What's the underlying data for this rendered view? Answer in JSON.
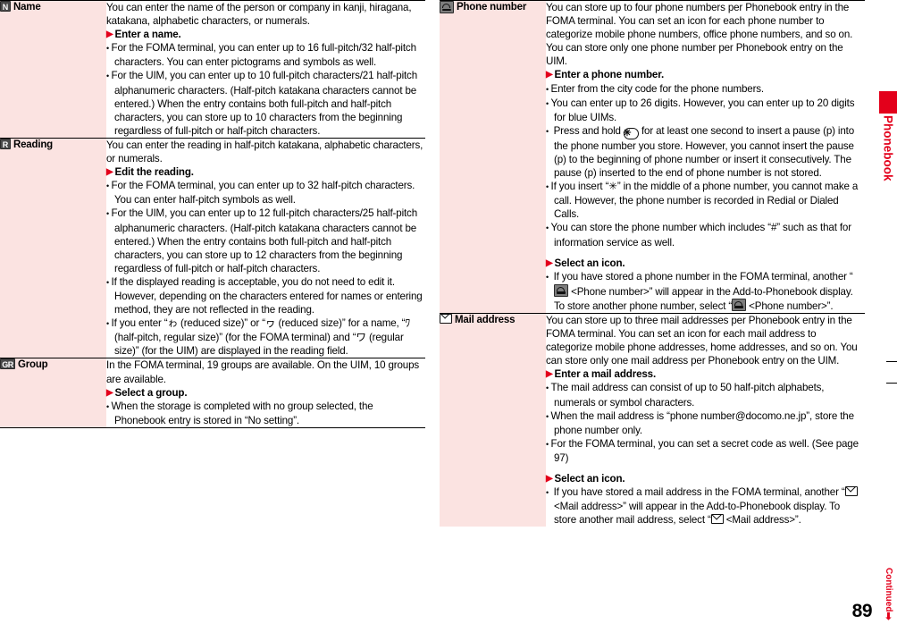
{
  "page": {
    "number": "89",
    "continued_label": "Continued",
    "side_tab_label": "Phonebook",
    "accent_color": "#e3001b",
    "label_bg_color": "#fbe3e1"
  },
  "left_column": {
    "rows": [
      {
        "icon_name": "name-icon",
        "icon_glyph": "N",
        "label": "Name",
        "blocks": [
          {
            "type": "para",
            "text": "You can enter the name of the person or company in kanji, hiragana, katakana, alphabetic characters, or numerals."
          },
          {
            "type": "heading",
            "text": "Enter a name."
          },
          {
            "type": "bullet",
            "text": "For the FOMA terminal, you can enter up to 16 full-pitch/32 half-pitch characters. You can enter pictograms and symbols as well."
          },
          {
            "type": "bullet",
            "text": "For the UIM, you can enter up to 10 full-pitch characters/21 half-pitch alphanumeric characters. (Half-pitch katakana characters cannot be entered.) When the entry contains both full-pitch and half-pitch characters, you can store up to 10 characters from the beginning regardless of full-pitch or half-pitch characters."
          }
        ]
      },
      {
        "icon_name": "reading-icon",
        "icon_glyph": "R",
        "label": "Reading",
        "blocks": [
          {
            "type": "para",
            "text": "You can enter the reading in half-pitch katakana, alphabetic characters, or numerals."
          },
          {
            "type": "heading",
            "text": "Edit the reading."
          },
          {
            "type": "bullet",
            "text": "For the FOMA terminal, you can enter up to 32 half-pitch characters. You can enter half-pitch symbols as well."
          },
          {
            "type": "bullet",
            "text": "For the UIM, you can enter up to 12 full-pitch characters/25 half-pitch alphanumeric characters. (Half-pitch katakana characters cannot be entered.) When the entry contains both full-pitch and half-pitch characters, you can store up to 12 characters from the beginning regardless of full-pitch or half-pitch characters."
          },
          {
            "type": "bullet",
            "text": "If the displayed reading is acceptable, you do not need to edit it. However, depending on the characters entered for names or entering method, they are not reflected in the reading."
          },
          {
            "type": "bullet",
            "text": "If you enter “ゎ (reduced size)” or “ヮ (reduced size)” for a name, “ﾜ (half-pitch, regular size)” (for the FOMA terminal) and “ワ (regular size)” (for the UIM) are displayed in the reading field."
          }
        ]
      },
      {
        "icon_name": "group-icon",
        "icon_glyph": "GR",
        "label": "Group",
        "blocks": [
          {
            "type": "para",
            "text": "In the FOMA terminal, 19 groups are available. On the UIM, 10 groups are available."
          },
          {
            "type": "heading",
            "text": "Select a group."
          },
          {
            "type": "bullet",
            "text": "When the storage is completed with no group selected, the Phonebook entry is stored in “No setting”."
          }
        ]
      }
    ]
  },
  "right_column": {
    "rows": [
      {
        "icon_name": "phone-number-icon",
        "label": "Phone number",
        "blocks": [
          {
            "type": "para",
            "text": "You can store up to four phone numbers per Phonebook entry in the FOMA terminal. You can set an icon for each phone number to categorize mobile phone numbers, office phone numbers, and so on. You can store only one phone number per Phonebook entry on the UIM."
          },
          {
            "type": "heading",
            "text": "Enter a phone number."
          },
          {
            "type": "bullet",
            "text": "Enter from the city code for the phone numbers."
          },
          {
            "type": "bullet",
            "text": "You can enter up to 26 digits. However, you can enter up to 20 digits for blue UIMs."
          },
          {
            "type": "bullet_with_key",
            "pre": "Press and hold ",
            "key": "✳",
            "post": " for at least one second to insert a pause (p) into the phone number you store. However, you cannot insert the pause (p) to the beginning of phone number or insert it consecutively. The pause (p) inserted to the end of phone number is not stored."
          },
          {
            "type": "bullet",
            "text": "If you insert “✳” in the middle of a phone number, you cannot make a call. However, the phone number is recorded in Redial or Dialed Calls."
          },
          {
            "type": "bullet",
            "text": "You can store the phone number which includes “#” such as that for information service as well."
          },
          {
            "type": "heading_spaced",
            "text": "Select an icon."
          },
          {
            "type": "bullet_with_phone_icons",
            "p1": "If you have stored a phone number in the FOMA terminal, another “",
            "p2": " <Phone number>” will appear in the Add-to-Phonebook display. To store another phone number, select “",
            "p3": " <Phone number>”."
          }
        ]
      },
      {
        "icon_name": "mail-address-icon",
        "label": "Mail address",
        "blocks": [
          {
            "type": "para",
            "text": "You can store up to three mail addresses per Phonebook entry in the FOMA terminal. You can set an icon for each mail address to categorize mobile phone addresses, home addresses, and so on. You can store only one mail address per Phonebook entry on the UIM."
          },
          {
            "type": "heading",
            "text": "Enter a mail address."
          },
          {
            "type": "bullet",
            "text": "The mail address can consist of up to 50 half-pitch alphabets, numerals or symbol characters."
          },
          {
            "type": "bullet",
            "text": "When the mail address is “phone number@docomo.ne.jp”, store the phone number only."
          },
          {
            "type": "bullet",
            "text": "For the FOMA terminal, you can set a secret code as well. (See page 97)"
          },
          {
            "type": "heading_spaced",
            "text": "Select an icon."
          },
          {
            "type": "bullet_with_mail_icons",
            "p1": "If you have stored a mail address in the FOMA terminal, another “",
            "p2": " <Mail address>” will appear in the Add-to-Phonebook display. To store another mail address, select “",
            "p3": " <Mail address>”."
          }
        ]
      }
    ]
  }
}
